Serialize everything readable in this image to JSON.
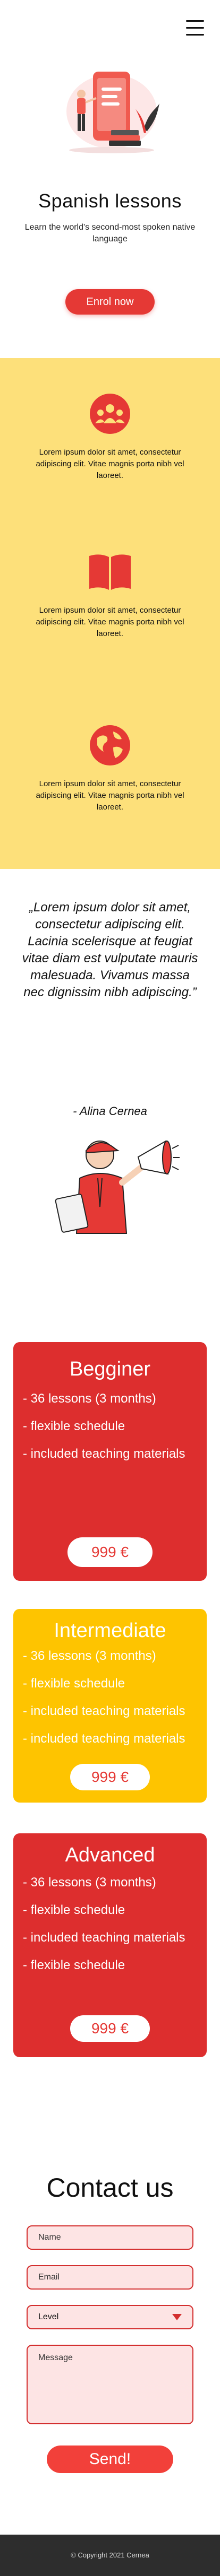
{
  "header": {
    "menu_icon": "hamburger-menu-icon"
  },
  "hero": {
    "title": "Spanish lessons",
    "subtitle": "Learn the world's second-most spoken native language",
    "enroll_label": "Enrol now"
  },
  "features": [
    {
      "icon": "people-group-icon",
      "text": "Lorem ipsum dolor sit amet, consectetur adipiscing elit. Vitae magnis porta nibh vel laoreet."
    },
    {
      "icon": "open-book-icon",
      "text": "Lorem ipsum dolor sit amet, consectetur adipiscing elit. Vitae magnis porta nibh vel laoreet."
    },
    {
      "icon": "globe-icon",
      "text": "Lorem ipsum dolor sit amet, consectetur adipiscing elit. Vitae magnis porta nibh vel laoreet."
    }
  ],
  "testimonial": {
    "quote": "„Lorem ipsum dolor sit amet, consectetur adipiscing elit. Lacinia scelerisque at feugiat vitae diam est vulputate mauris malesuada. Vivamus massa nec dignissim nibh adipiscing.”",
    "author": "- Alina Cernea"
  },
  "plans": [
    {
      "title": "Begginer",
      "features": [
        "- 36 lessons (3 months)",
        "- flexible schedule",
        "- included teaching materials"
      ],
      "price": "999 €",
      "color": "#dd2e2e"
    },
    {
      "title": "Intermediate",
      "features": [
        "- 36 lessons (3 months)",
        "- flexible schedule",
        "- included teaching materials",
        "- included teaching materials"
      ],
      "price": "999 €",
      "color": "#fec400"
    },
    {
      "title": "Advanced",
      "features": [
        "- 36 lessons (3 months)",
        "- flexible schedule",
        "- included teaching materials",
        "- flexible schedule"
      ],
      "price": "999 €",
      "color": "#dd2e2e"
    }
  ],
  "contact": {
    "title": "Contact us",
    "name_placeholder": "Name",
    "email_placeholder": "Email",
    "level_value": "Level",
    "message_placeholder": "Message",
    "send_label": "Send!"
  },
  "footer": {
    "copyright": "© Copyright 2021 Cernea"
  },
  "colors": {
    "accent": "#e53935",
    "yellow_band": "#fde07a",
    "plan_yellow": "#fec400",
    "footer": "#2d2d2d"
  }
}
